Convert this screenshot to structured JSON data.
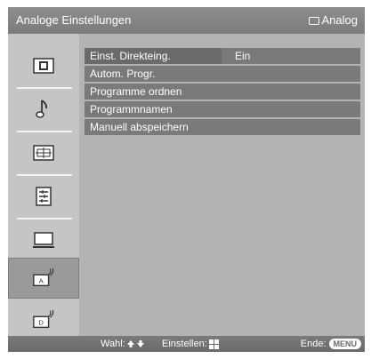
{
  "header": {
    "title": "Analoge Einstellungen",
    "mode_label": "Analog"
  },
  "sidebar": {
    "items": [
      {
        "name": "picture-settings",
        "icon": "picture-icon",
        "selected": false
      },
      {
        "name": "sound-settings",
        "icon": "music-note-icon",
        "selected": false
      },
      {
        "name": "screen-settings",
        "icon": "screen-adjust-icon",
        "selected": false
      },
      {
        "name": "setup-settings",
        "icon": "setup-list-icon",
        "selected": false
      },
      {
        "name": "pc-settings",
        "icon": "pc-monitor-icon",
        "selected": false
      },
      {
        "name": "analog-settings",
        "icon": "analog-antenna-icon",
        "selected": true
      },
      {
        "name": "digital-settings",
        "icon": "digital-antenna-icon",
        "selected": false
      }
    ]
  },
  "menu": {
    "items": [
      {
        "label": "Einst. Direkteing.",
        "value": "Ein"
      },
      {
        "label": "Autom. Progr."
      },
      {
        "label": "Programme ordnen"
      },
      {
        "label": "Programmnamen"
      },
      {
        "label": "Manuell abspeichern"
      }
    ]
  },
  "footer": {
    "wahl_label": "Wahl:",
    "einstellen_label": "Einstellen:",
    "ende_label": "Ende:",
    "menu_button": "MENU"
  },
  "colors": {
    "bar": "#7b7b7b",
    "panel": "#b3b3b3",
    "sidebar": "#c5c5c5",
    "selected_tab": "#9a9a9a",
    "text": "#ffffff"
  }
}
